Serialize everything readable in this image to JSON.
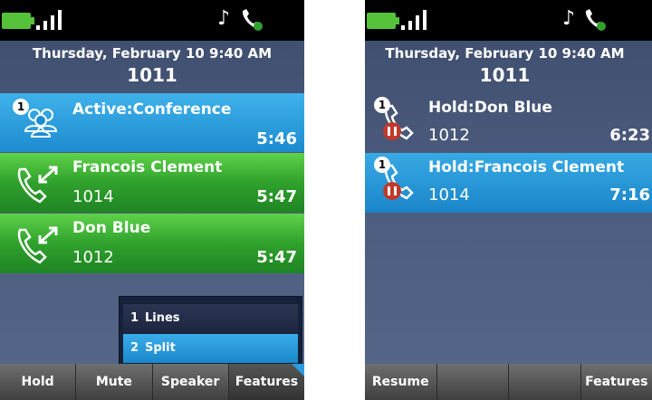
{
  "phone1": {
    "date": "Thursday, February 10 9:40 AM",
    "extension": "1011",
    "calls": [
      {
        "badge": "1",
        "title": "Active:Conference",
        "number": "",
        "timer": "5:46"
      },
      {
        "title": "Francois Clement",
        "number": "1014",
        "timer": "5:47"
      },
      {
        "title": "Don Blue",
        "number": "1012",
        "timer": "5:47"
      }
    ],
    "menu": [
      {
        "num": "1",
        "label": "Lines"
      },
      {
        "num": "2",
        "label": "Split"
      }
    ],
    "softkeys": [
      "Hold",
      "Mute",
      "Speaker",
      "Features"
    ]
  },
  "phone2": {
    "date": "Thursday, February 10 9:40 AM",
    "extension": "1011",
    "calls": [
      {
        "badge": "1",
        "title": "Hold:Don Blue",
        "number": "1012",
        "timer": "6:23"
      },
      {
        "badge": "1",
        "title": "Hold:Francois Clement",
        "number": "1014",
        "timer": "7:16"
      }
    ],
    "softkeys": [
      "Resume",
      "",
      "",
      "Features"
    ]
  },
  "colors": {
    "active_blue": "#1c8ccf",
    "call_green": "#2fa12c",
    "battery_green": "#55c23a",
    "hold_red": "#c0392b"
  },
  "icons": [
    "battery-icon",
    "signal-icon",
    "music-note-icon",
    "handset-icon",
    "conference-icon",
    "transfer-handset-icon",
    "hold-handset-icon"
  ]
}
